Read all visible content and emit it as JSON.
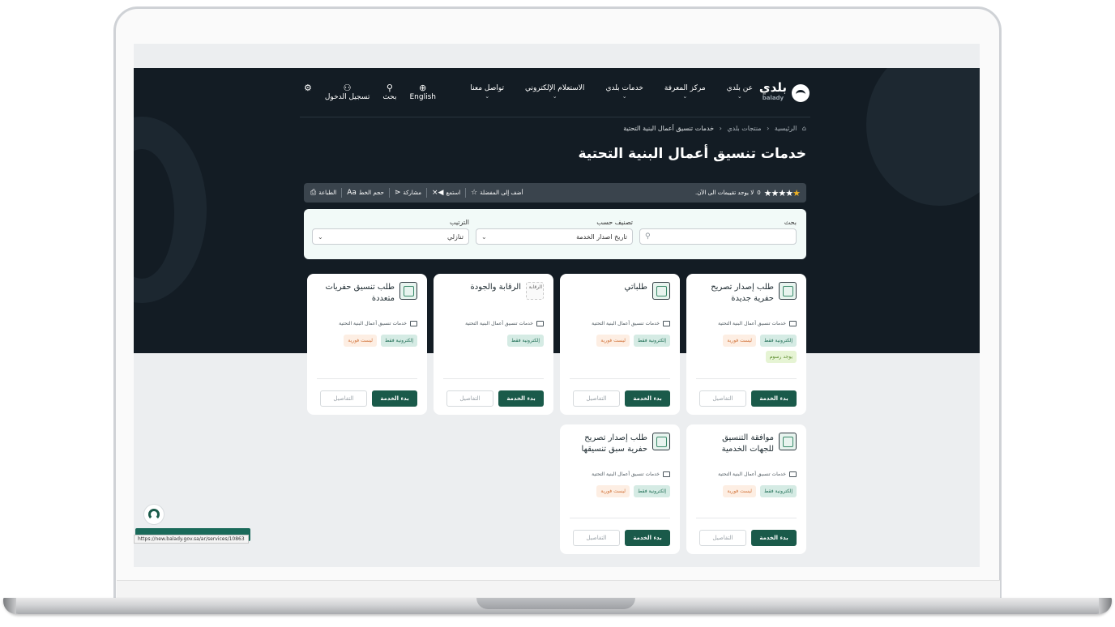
{
  "nav": {
    "logo_text": "بلدي",
    "logo_sub": "balady",
    "items": [
      {
        "label": "عن بلدي"
      },
      {
        "label": "مركز المعرفة"
      },
      {
        "label": "خدمات بلدي"
      },
      {
        "label": "الاستعلام الإلكتروني"
      },
      {
        "label": "تواصل معنا"
      }
    ],
    "tools": {
      "language": "English",
      "search": "بحث",
      "login": "تسجيل الدخول"
    }
  },
  "breadcrumb": {
    "home": "الرئيسية",
    "section": "منتجات بلدي",
    "current": "خدمات تنسيق أعمال البنية التحتية"
  },
  "page_title": "خدمات تنسيق أعمال البنية التحتية",
  "rating": {
    "count": "0",
    "text": "لا يوجد تقييمات الى الآن."
  },
  "actions": {
    "favorite": "أضف إلى المفضلة",
    "listen": "استمع",
    "share": "مشاركة",
    "font_size": "حجم الخط",
    "print": "الطباعة"
  },
  "filters": {
    "search_label": "بحث",
    "search_value": "",
    "classify_label": "تصنيف حسب",
    "classify_value": "تاريخ اصدار الخدمة",
    "sort_label": "الترتيب",
    "sort_value": "تنازلي"
  },
  "cards": [
    {
      "title": "طلب إصدار تصريح حفرية جديدة",
      "category": "خدمات تنسيق أعمال البنية التحتية",
      "tag1": "إلكترونية فقط",
      "tag2": "ليست فورية",
      "tag3": "يوجد رسوم"
    },
    {
      "title": "طلباتي",
      "category": "خدمات تنسيق أعمال البنية التحتية",
      "tag1": "إلكترونية فقط",
      "tag2": "ليست فورية"
    },
    {
      "title": "الرقابة والجودة",
      "icon_alt": "الرقابة",
      "category": "خدمات تنسيق أعمال البنية التحتية",
      "tag1": "إلكترونية فقط"
    },
    {
      "title": "طلب تنسيق حفريات متعددة",
      "category": "خدمات تنسيق أعمال البنية التحتية",
      "tag1": "إلكترونية فقط",
      "tag2": "ليست فورية"
    },
    {
      "title": "موافقة التنسيق للجهات الخدمية",
      "category": "خدمات تنسيق أعمال البنية التحتية",
      "tag1": "إلكترونية فقط",
      "tag2": "ليست فورية"
    },
    {
      "title": "طلب إصدار تصريح حفرية سبق تنسيقها",
      "category": "خدمات تنسيق أعمال البنية التحتية",
      "tag1": "إلكترونية فقط",
      "tag2": "ليست فورية"
    }
  ],
  "buttons": {
    "start": "بدء الخدمة",
    "details": "التفاصيل"
  },
  "status_url": "https://new.balady.gov.sa/ar/services/10863",
  "colors": {
    "hero_bg": "#131c24",
    "primary": "#1a5a4a",
    "star": "#f0b323"
  }
}
